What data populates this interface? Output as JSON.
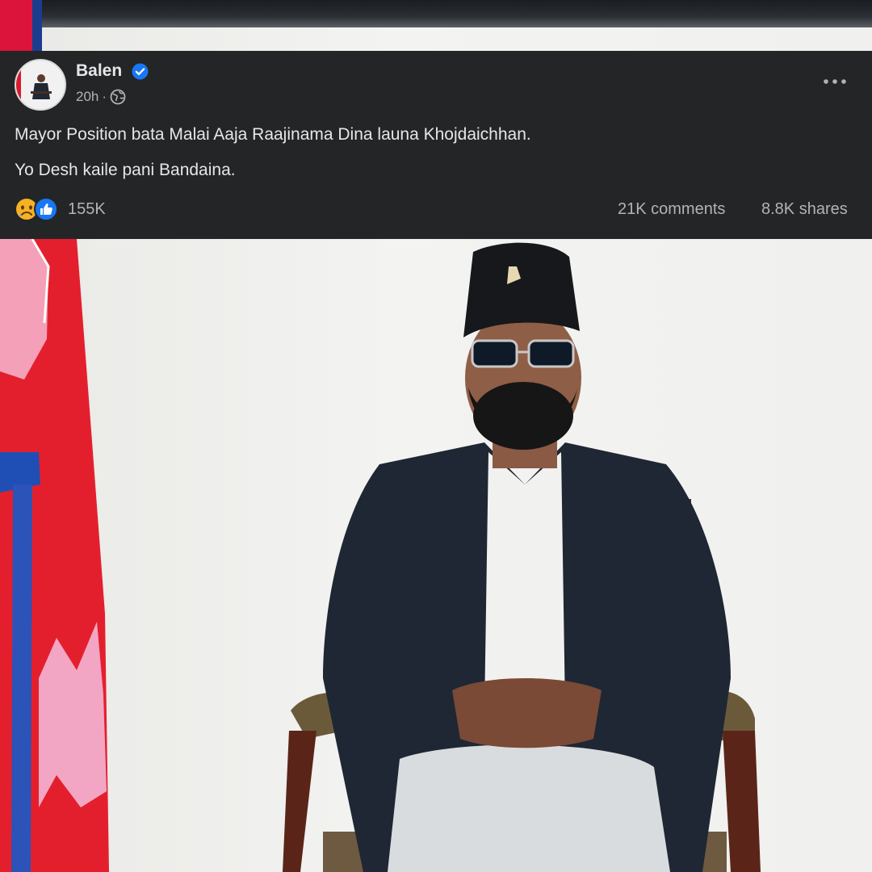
{
  "post": {
    "author": "Balen",
    "verified": true,
    "time": "20h",
    "separator": "·",
    "audience_icon": "globe-icon",
    "more_icon": "more-options-icon",
    "message_lines": [
      "Mayor Position bata Malai Aaja Raajinama Dina launa Khojdaichhan.",
      "Yo Desh kaile pani Bandaina."
    ],
    "reaction_icons": [
      "sad-reaction-icon",
      "like-reaction-icon"
    ],
    "reaction_count": "155K",
    "comments": "21K comments",
    "shares": "8.8K shares"
  },
  "colors": {
    "card_bg": "#242526",
    "text_primary": "#e4e6eb",
    "text_secondary": "#b0b3b8",
    "verified_blue": "#1877f2",
    "like_blue": "#1877f2",
    "sad_yellow": "#f7b125",
    "flag_red": "#dc143c",
    "flag_blue": "#003893"
  }
}
